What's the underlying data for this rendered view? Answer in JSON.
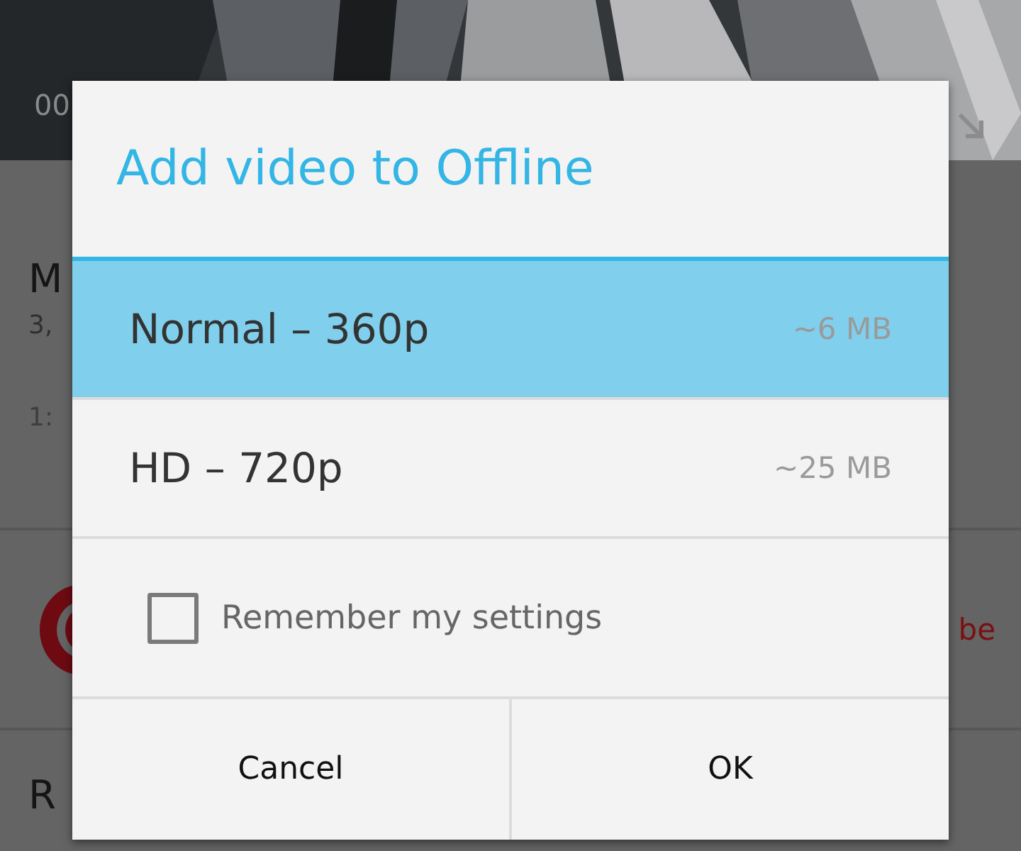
{
  "video": {
    "kind": "picture",
    "time": "00"
  },
  "page": {
    "title": "M",
    "views": "3,",
    "date": "1:",
    "subscribe": "be",
    "next_heading": "R"
  },
  "dialog": {
    "title": "Add video to Offline",
    "options": [
      {
        "label": "Normal – 360p",
        "size": "~6 MB",
        "selected": true
      },
      {
        "label": "HD – 720p",
        "size": "~25 MB",
        "selected": false
      }
    ],
    "remember": {
      "label": "Remember my settings",
      "checked": false
    },
    "buttons": [
      "Cancel",
      "OK"
    ]
  }
}
